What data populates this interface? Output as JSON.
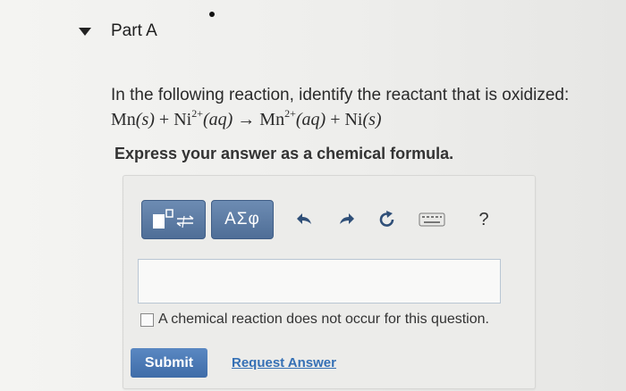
{
  "part": {
    "title": "Part A"
  },
  "question": {
    "prompt": "In the following reaction, identify the reactant that is oxidized:",
    "equation": {
      "lhs1": "Mn",
      "lhs1_state": "(s)",
      "plus1": " + ",
      "lhs2": "Ni",
      "lhs2_charge": "2+",
      "lhs2_state": "(aq)",
      "arrow": " → ",
      "rhs1": "Mn",
      "rhs1_charge": "2+",
      "rhs1_state": "(aq)",
      "plus2": " + ",
      "rhs2": "Ni",
      "rhs2_state": "(s)"
    },
    "instruction": "Express your answer as a chemical formula."
  },
  "toolbar": {
    "greek_label": "ΑΣφ",
    "help_label": "?"
  },
  "answer": {
    "value": "",
    "no_reaction_label": "A chemical reaction does not occur for this question."
  },
  "actions": {
    "submit_label": "Submit",
    "request_label": "Request Answer"
  },
  "colors": {
    "toolbar_button": "#5b7aa3",
    "submit_button": "#4a7ab8",
    "link": "#3570b5"
  }
}
